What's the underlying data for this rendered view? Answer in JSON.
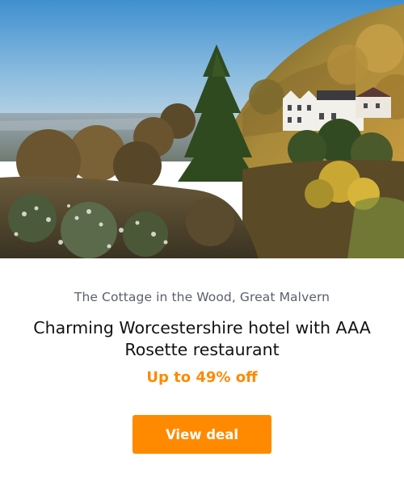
{
  "card": {
    "image_alt": "The Cottage in the Wood hotel on a wooded hillside overlooking the valley",
    "location": "The Cottage in the Wood, Great Malvern",
    "title": "Charming Worcestershire hotel with AAA Rosette restaurant",
    "discount": "Up to 49% off",
    "cta_label": "View deal"
  },
  "colors": {
    "accent": "#ff8a00",
    "title_text": "#121212",
    "location_text": "#5a5f6b"
  }
}
